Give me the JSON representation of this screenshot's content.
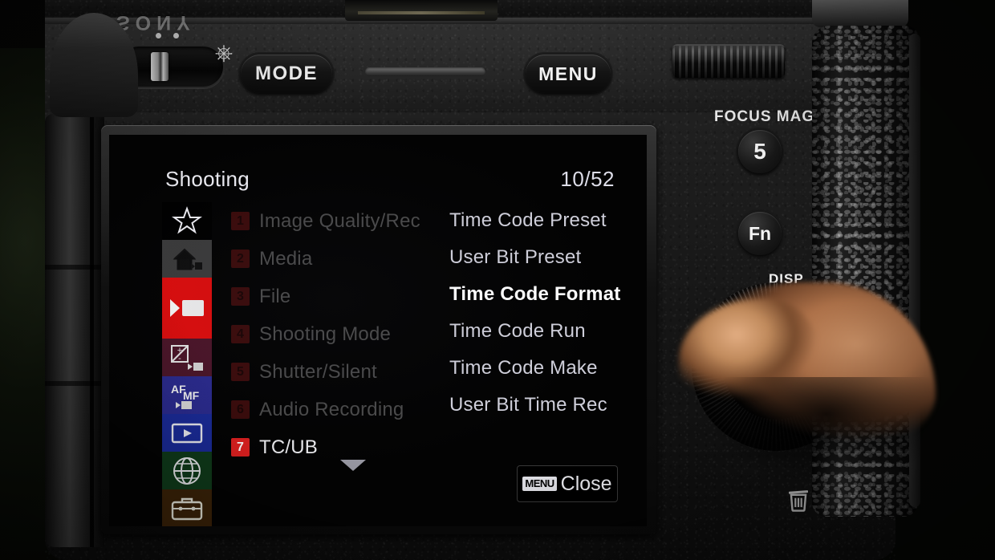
{
  "camera": {
    "brand": "SONY",
    "top_controls": {
      "power_icon": "power-icon",
      "mode_button": "MODE",
      "menu_button": "MENU",
      "speaker": "speaker-slot",
      "knurled_dial": "front-dial"
    },
    "rear_controls": {
      "focus_mag_label": "FOCUS MAG",
      "custom_button_5": "5",
      "fn_button": "Fn",
      "disp_label": "DISP",
      "delete_icon": "trash-icon"
    }
  },
  "lcd": {
    "title": "Shooting",
    "page_indicator": "10/52",
    "sidebar": [
      {
        "name": "my-menu-star-icon",
        "icon": "star",
        "color": "#000000",
        "selected": false
      },
      {
        "name": "main-shooting-icon",
        "icon": "home-camera",
        "color": "#3a3a3a",
        "selected": false
      },
      {
        "name": "movie-shooting-icon",
        "icon": "movie",
        "color": "#d80d0d",
        "selected": true
      },
      {
        "name": "exposure-color-icon",
        "icon": "exposure",
        "color": "#4a1528",
        "selected": false
      },
      {
        "name": "focus-icon",
        "icon": "af-mf",
        "color": "#2a2a8c",
        "selected": false
      },
      {
        "name": "playback-icon",
        "icon": "playback",
        "color": "#1a2a96",
        "selected": false
      },
      {
        "name": "network-icon",
        "icon": "globe",
        "color": "#0f3a1a",
        "selected": false
      },
      {
        "name": "setup-icon",
        "icon": "toolbox",
        "color": "#3a2208",
        "selected": false
      }
    ],
    "categories": [
      {
        "num": "1",
        "label": "Image Quality/Rec",
        "selected": false
      },
      {
        "num": "2",
        "label": "Media",
        "selected": false
      },
      {
        "num": "3",
        "label": "File",
        "selected": false
      },
      {
        "num": "4",
        "label": "Shooting Mode",
        "selected": false
      },
      {
        "num": "5",
        "label": "Shutter/Silent",
        "selected": false
      },
      {
        "num": "6",
        "label": "Audio Recording",
        "selected": false
      },
      {
        "num": "7",
        "label": "TC/UB",
        "selected": true
      }
    ],
    "scroll_down_indicator": "chevron-down-icon",
    "items": [
      {
        "label": "Time Code Preset",
        "highlight": false
      },
      {
        "label": "User Bit Preset",
        "highlight": false
      },
      {
        "label": "Time Code Format",
        "highlight": true
      },
      {
        "label": "Time Code Run",
        "highlight": false
      },
      {
        "label": "Time Code Make",
        "highlight": false
      },
      {
        "label": "User Bit Time Rec",
        "highlight": false
      }
    ],
    "close_button": {
      "tag": "MENU",
      "label": "Close"
    },
    "colors": {
      "accent_red": "#d80d0d",
      "selected_text": "#ffffff",
      "dim_text": "#4a4a4a",
      "body_text": "#cfcfda"
    }
  }
}
